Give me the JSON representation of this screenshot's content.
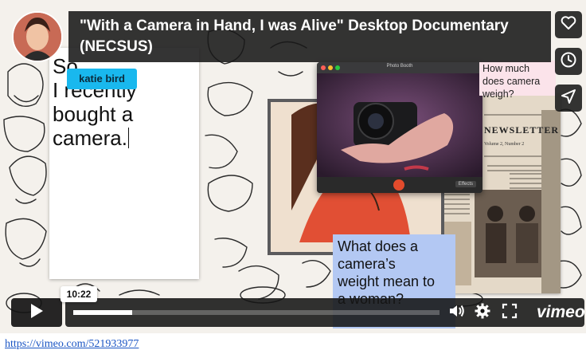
{
  "video": {
    "title": "\"With a Camera in Hand, I was Alive\" Desktop Documentary (NECSUS)",
    "progress_percent": 16
  },
  "document": {
    "text": "So,\nI recently\nbought a\ncamera."
  },
  "user_tag": "katie bird",
  "questions": {
    "weigh": "How much does camera weigh?",
    "weight": "What does a\ncamera’s\nweight mean to\na woman?"
  },
  "newsletter": {
    "heading": "NEWSLETTER",
    "subtitle": "Volume 2, Number 2"
  },
  "photo_booth": {
    "window_title": "Photo Booth",
    "effects_label": "Effects"
  },
  "controls": {
    "time": "10:22",
    "logo": "vimeo"
  },
  "icons": {
    "like": "heart-icon",
    "watch_later": "clock-icon",
    "share": "send-icon",
    "play": "play-icon",
    "volume": "volume-icon",
    "settings": "gear-icon",
    "fullscreen": "fullscreen-icon"
  },
  "link": {
    "url_text": "https://vimeo.com/521933977"
  },
  "colors": {
    "user_tag": "#19b8ee",
    "question_weight_bg": "#b3c8f3",
    "question_weigh_bg": "#fbe3ea",
    "link": "#1a55c4"
  }
}
